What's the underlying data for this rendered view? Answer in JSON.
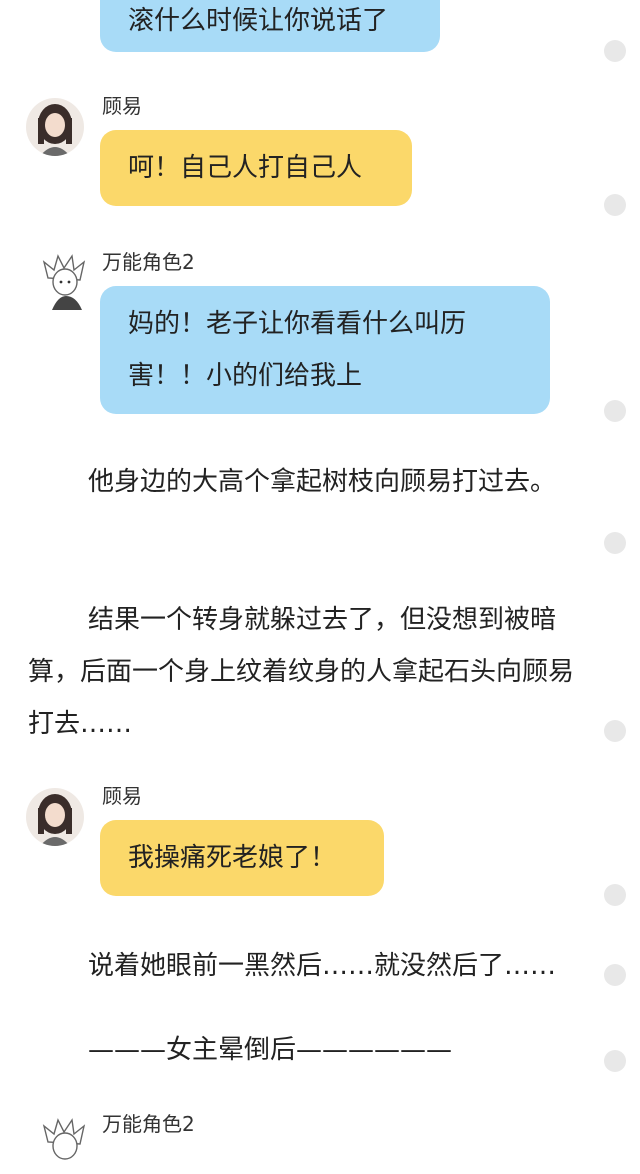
{
  "messages": [
    {
      "text": "滚什么时候让你说话了"
    },
    {
      "name": "顾易",
      "text": "呵！自己人打自己人"
    },
    {
      "name": "万能角色2",
      "text": "妈的！老子让你看看什么叫历害！！小的们给我上"
    },
    {
      "name": "顾易",
      "text": "我操痛死老娘了！"
    },
    {
      "name": "万能角色2"
    }
  ],
  "narration": {
    "p1": "他身边的大高个拿起树枝向顾易打过去。",
    "p2": "结果一个转身就躲过去了，但没想到被暗算，后面一个身上纹着纹身的人拿起石头向顾易打去……",
    "p3": "说着她眼前一黑然后……就没然后了……",
    "p4": "———女主晕倒后——————"
  },
  "colors": {
    "blue_bubble": "#a8dbf7",
    "yellow_bubble": "#fbd86a"
  }
}
